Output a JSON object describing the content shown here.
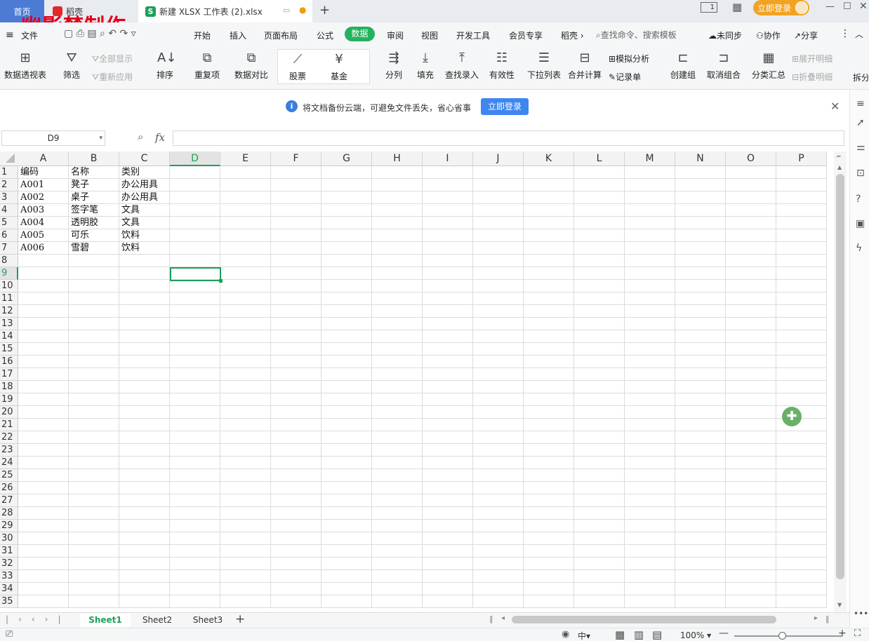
{
  "titlebar": {
    "tab_home": "首页",
    "tab_daoke": "稻壳",
    "tab_file": "新建 XLSX 工作表 (2).xlsx",
    "new_tab": "+",
    "login": "立即登录",
    "page_indicator": "1",
    "watermark": "幽影梦制作"
  },
  "menu": {
    "file": "文件",
    "items": [
      "开始",
      "插入",
      "页面布局",
      "公式",
      "数据",
      "审阅",
      "视图",
      "开发工具",
      "会员专享",
      "稻壳"
    ],
    "search_placeholder": "查找命令、搜索模板",
    "unsync": "未同步",
    "collab": "协作",
    "share": "分享"
  },
  "ribbon": {
    "pivot": "数据透视表",
    "filter": "筛选",
    "show_all": "全部显示",
    "reapply": "重新应用",
    "sort": "排序",
    "duplicates": "重复项",
    "compare": "数据对比",
    "stock": "股票",
    "fund": "基金",
    "split": "分列",
    "fill": "填充",
    "lookup": "查找录入",
    "validity": "有效性",
    "dropdown": "下拉列表",
    "consolidate": "合并计算",
    "whatif": "模拟分析",
    "record": "记录单",
    "group": "创建组",
    "ungroup": "取消组合",
    "subtotal": "分类汇总",
    "expand": "展开明细",
    "collapse": "折叠明细",
    "split2": "拆分"
  },
  "notice": {
    "text": "将文档备份云端，可避免文件丢失，省心省事",
    "button": "立即登录"
  },
  "formula": {
    "namebox": "D9",
    "fx": "fx"
  },
  "columns": [
    "A",
    "B",
    "C",
    "D",
    "E",
    "F",
    "G",
    "H",
    "I",
    "J",
    "K",
    "L",
    "M",
    "N",
    "O",
    "P"
  ],
  "rows": [
    "1",
    "2",
    "3",
    "4",
    "5",
    "6",
    "7",
    "8",
    "9",
    "10",
    "11",
    "12",
    "13",
    "14",
    "15",
    "16",
    "17",
    "18",
    "19",
    "20",
    "21",
    "22",
    "23",
    "24",
    "25",
    "26",
    "27",
    "28",
    "29",
    "30",
    "31",
    "32",
    "33",
    "34",
    "35"
  ],
  "table": [
    [
      "编码",
      "名称",
      "类别"
    ],
    [
      "A001",
      "凳子",
      "办公用具"
    ],
    [
      "A002",
      "桌子",
      "办公用具"
    ],
    [
      "A003",
      "签字笔",
      "文具"
    ],
    [
      "A004",
      "透明胶",
      "文具"
    ],
    [
      "A005",
      "可乐",
      "饮料"
    ],
    [
      "A006",
      "雪碧",
      "饮料"
    ]
  ],
  "sheets": [
    "Sheet1",
    "Sheet2",
    "Sheet3"
  ],
  "status": {
    "zoom": "100%",
    "lang": "中"
  }
}
